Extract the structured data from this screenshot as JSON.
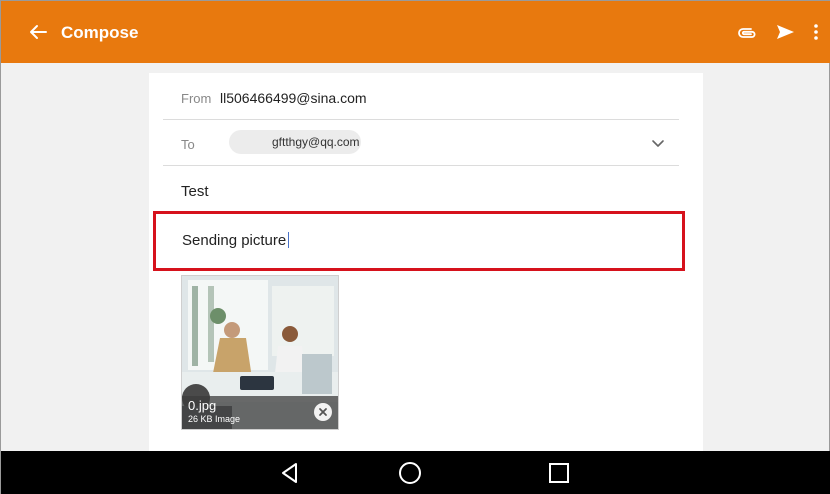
{
  "appbar": {
    "title": "Compose",
    "icons": [
      "back-arrow-icon",
      "paperclip-icon",
      "send-icon",
      "more-vertical-icon"
    ],
    "background": "#e8790e"
  },
  "compose": {
    "from_label": "From",
    "from_value": "ll506466499@sina.com",
    "to_label": "To",
    "to_recipient": "gftthgy@qq.com",
    "subject": "Test",
    "body": "Sending picture",
    "highlight_color": "#d6121c"
  },
  "attachment": {
    "file_name": "0.jpg",
    "file_info": "26 KB Image"
  },
  "navbar": {
    "icons": [
      "back-triangle-icon",
      "home-circle-icon",
      "recents-square-icon"
    ]
  }
}
